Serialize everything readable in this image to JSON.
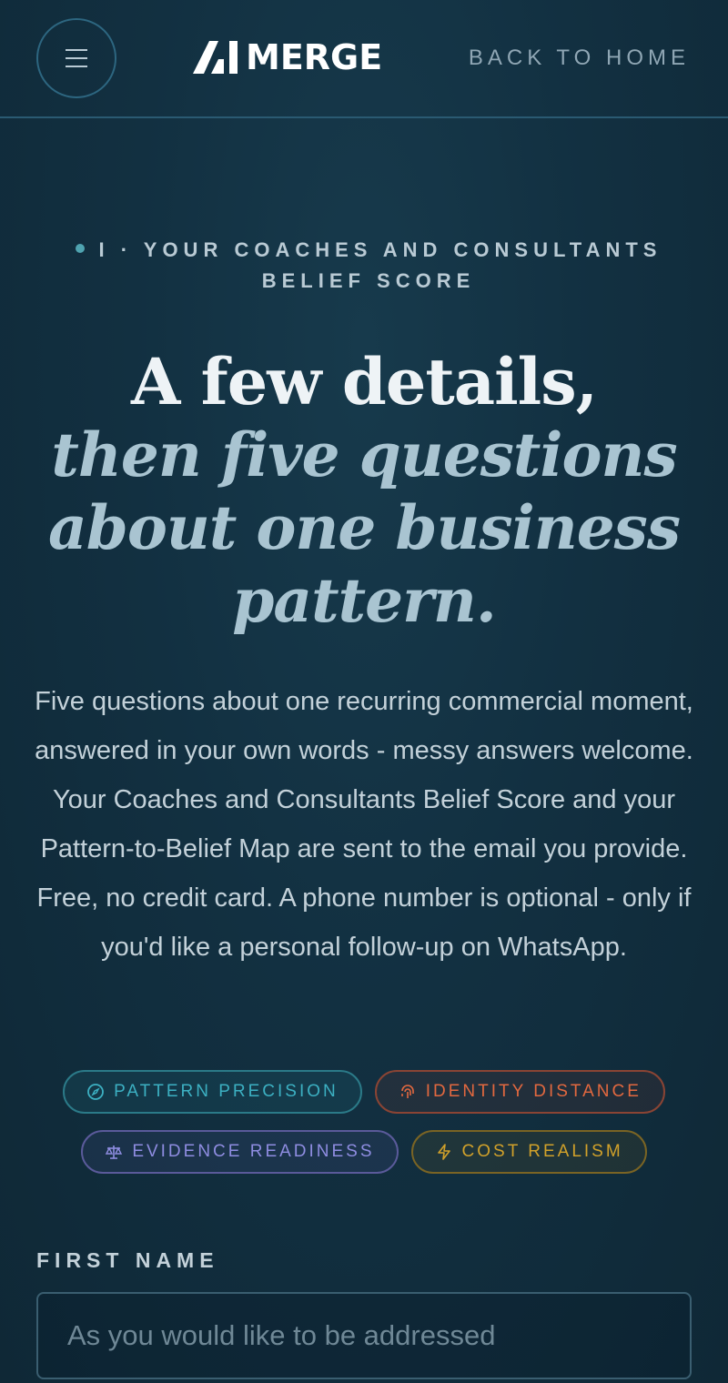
{
  "header": {
    "logo_text": "MERGE",
    "back_link": "BACK TO HOME"
  },
  "eyebrow": {
    "line1": "I · YOUR COACHES AND CONSULTANTS",
    "line2": "BELIEF SCORE"
  },
  "title": {
    "line1": "A few details,",
    "line2": "then five questions",
    "line3": "about one business",
    "line4": "pattern."
  },
  "description": "Five questions about one recurring commercial moment, answered in your own words - messy answers welcome. Your Coaches and Consultants Belief Score and your Pattern-to-Belief Map are sent to the email you provide. Free, no credit card. A phone number is optional - only if you'd like a personal follow-up on WhatsApp.",
  "tags": [
    {
      "label": "PATTERN PRECISION",
      "icon": "compass-icon",
      "color": "#3cb0c2"
    },
    {
      "label": "IDENTITY DISTANCE",
      "icon": "fingerprint-icon",
      "color": "#e2683f"
    },
    {
      "label": "EVIDENCE READINESS",
      "icon": "scales-icon",
      "color": "#8e8ce0"
    },
    {
      "label": "COST REALISM",
      "icon": "lightning-icon",
      "color": "#d1a12a"
    }
  ],
  "form": {
    "first_name_label": "FIRST NAME",
    "first_name_placeholder": "As you would like to be addressed"
  }
}
